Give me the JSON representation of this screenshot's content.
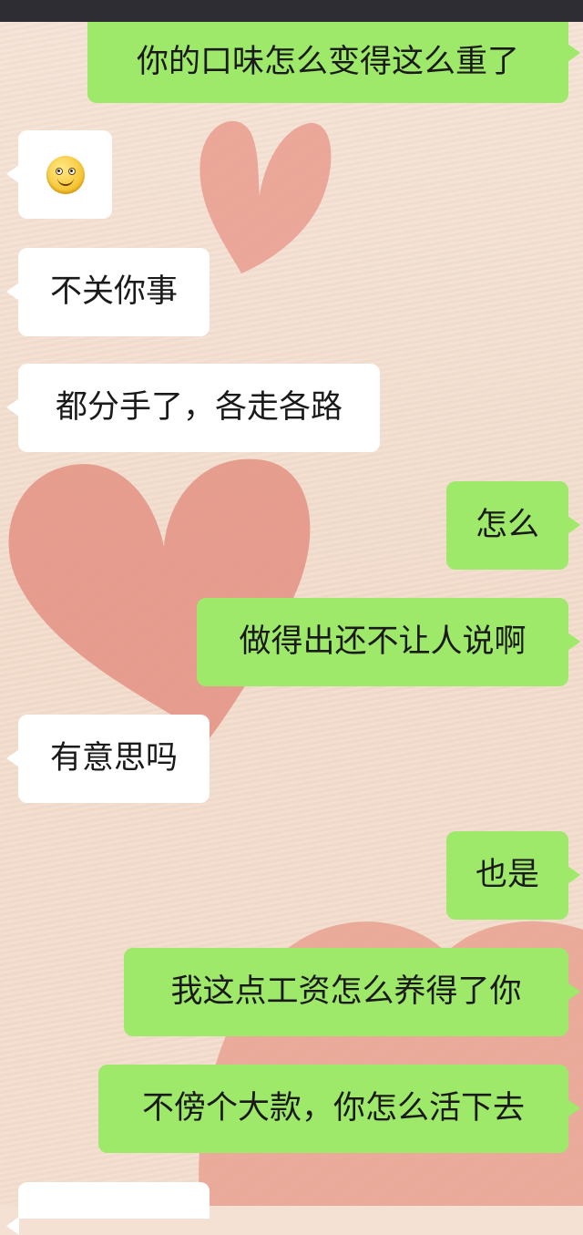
{
  "conversation": {
    "messages": [
      {
        "side": "right",
        "text": "你的口味怎么变得这么重了"
      },
      {
        "side": "left",
        "emoji": "smiley-emoji",
        "text": ""
      },
      {
        "side": "left",
        "text": "不关你事"
      },
      {
        "side": "left",
        "text": "都分手了，各走各路"
      },
      {
        "side": "right",
        "text": "怎么"
      },
      {
        "side": "right",
        "text": "做得出还不让人说啊"
      },
      {
        "side": "left",
        "text": "有意思吗"
      },
      {
        "side": "right",
        "text": "也是"
      },
      {
        "side": "right",
        "text": "我这点工资怎么养得了你"
      },
      {
        "side": "right",
        "text": "不傍个大款，你怎么活下去"
      },
      {
        "side": "left",
        "text": ""
      }
    ]
  },
  "colors": {
    "sent_bubble": "#9ee86a",
    "received_bubble": "#ffffff",
    "background": "#f4e1d3",
    "heart": "#e79a8a",
    "status_bar": "#2d2d33"
  }
}
